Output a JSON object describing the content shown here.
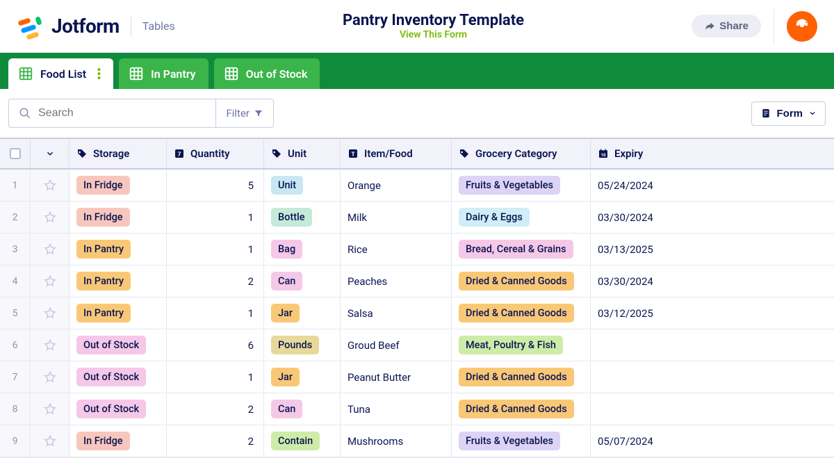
{
  "header": {
    "brand": "Jotform",
    "product": "Tables",
    "title": "Pantry Inventory Template",
    "view_form": "View This Form",
    "share": "Share"
  },
  "tabs": [
    {
      "label": "Food List",
      "active": true
    },
    {
      "label": "In Pantry",
      "active": false
    },
    {
      "label": "Out of Stock",
      "active": false
    }
  ],
  "toolbar": {
    "search_placeholder": "Search",
    "filter": "Filter",
    "form": "Form"
  },
  "columns": {
    "storage": "Storage",
    "quantity": "Quantity",
    "unit": "Unit",
    "item": "Item/Food",
    "category": "Grocery Category",
    "expiry": "Expiry"
  },
  "rows": [
    {
      "n": "1",
      "storage": "In Fridge",
      "storage_cls": "pill-infridge",
      "qty": "5",
      "unit": "Unit",
      "unit_cls": "pill-unit",
      "item": "Orange",
      "cat": "Fruits & Vegetables",
      "cat_cls": "pill-fruits",
      "expiry": "05/24/2024"
    },
    {
      "n": "2",
      "storage": "In Fridge",
      "storage_cls": "pill-infridge",
      "qty": "1",
      "unit": "Bottle",
      "unit_cls": "pill-bottle",
      "item": "Milk",
      "cat": "Dairy & Eggs",
      "cat_cls": "pill-dairy",
      "expiry": "03/30/2024"
    },
    {
      "n": "3",
      "storage": "In Pantry",
      "storage_cls": "pill-inpantry",
      "qty": "1",
      "unit": "Bag",
      "unit_cls": "pill-bag",
      "item": "Rice",
      "cat": "Bread, Cereal & Grains",
      "cat_cls": "pill-bread",
      "expiry": "03/13/2025"
    },
    {
      "n": "4",
      "storage": "In Pantry",
      "storage_cls": "pill-inpantry",
      "qty": "2",
      "unit": "Can",
      "unit_cls": "pill-can",
      "item": "Peaches",
      "cat": "Dried & Canned Goods",
      "cat_cls": "pill-dried",
      "expiry": "03/30/2024"
    },
    {
      "n": "5",
      "storage": "In Pantry",
      "storage_cls": "pill-inpantry",
      "qty": "1",
      "unit": "Jar",
      "unit_cls": "pill-jar",
      "item": "Salsa",
      "cat": "Dried & Canned Goods",
      "cat_cls": "pill-dried",
      "expiry": "03/12/2025"
    },
    {
      "n": "6",
      "storage": "Out of Stock",
      "storage_cls": "pill-outstock",
      "qty": "6",
      "unit": "Pounds",
      "unit_cls": "pill-pounds",
      "item": "Groud Beef",
      "cat": "Meat, Poultry & Fish",
      "cat_cls": "pill-meat",
      "expiry": ""
    },
    {
      "n": "7",
      "storage": "Out of Stock",
      "storage_cls": "pill-outstock",
      "qty": "1",
      "unit": "Jar",
      "unit_cls": "pill-jar",
      "item": "Peanut Butter",
      "cat": "Dried & Canned Goods",
      "cat_cls": "pill-dried",
      "expiry": ""
    },
    {
      "n": "8",
      "storage": "Out of Stock",
      "storage_cls": "pill-outstock",
      "qty": "2",
      "unit": "Can",
      "unit_cls": "pill-can",
      "item": "Tuna",
      "cat": "Dried & Canned Goods",
      "cat_cls": "pill-dried",
      "expiry": ""
    },
    {
      "n": "9",
      "storage": "In Fridge",
      "storage_cls": "pill-infridge",
      "qty": "2",
      "unit": "Contain",
      "unit_cls": "pill-contain",
      "item": "Mushrooms",
      "cat": "Fruits & Vegetables",
      "cat_cls": "pill-fruits",
      "expiry": "05/07/2024"
    }
  ]
}
